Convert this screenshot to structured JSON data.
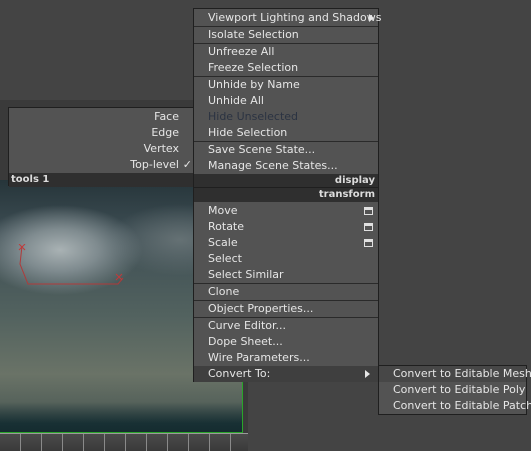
{
  "tools1": {
    "items": [
      "Face",
      "Edge",
      "Vertex",
      "Top-level"
    ],
    "checked_index": 3,
    "check_glyph": "✓",
    "header": "tools 1"
  },
  "display": {
    "items": [
      "Viewport Lighting and Shadows",
      "Isolate Selection",
      "Unfreeze All",
      "Freeze Selection",
      "Unhide by Name",
      "Unhide All",
      "Hide Unselected",
      "Hide Selection",
      "Save Scene State...",
      "Manage Scene States..."
    ],
    "header": "display"
  },
  "transform": {
    "header": "transform",
    "items": [
      "Move",
      "Rotate",
      "Scale",
      "Select",
      "Select Similar",
      "Clone",
      "Object Properties...",
      "Curve Editor...",
      "Dope Sheet...",
      "Wire Parameters...",
      "Convert To:"
    ]
  },
  "convert_submenu": {
    "items": [
      "Convert to Editable Mesh",
      "Convert to Editable Poly",
      "Convert to Editable Patch"
    ]
  },
  "colors": {
    "menu_bg": "#535353",
    "header_bg": "#2f2f2f",
    "disabled_text": "#2b3342",
    "grid_green": "#2aa52a"
  }
}
